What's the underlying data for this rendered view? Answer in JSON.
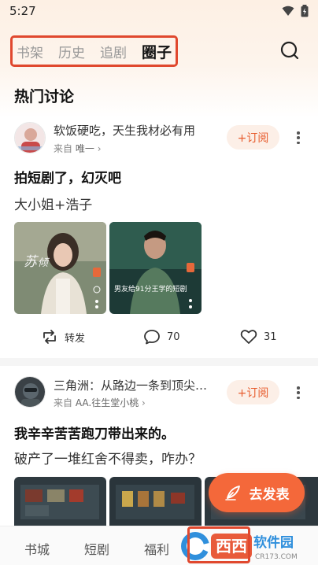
{
  "status_bar": {
    "time": "5:27"
  },
  "tabs": [
    {
      "label": "书架",
      "active": false
    },
    {
      "label": "历史",
      "active": false
    },
    {
      "label": "追剧",
      "active": false
    },
    {
      "label": "圈子",
      "active": true
    }
  ],
  "section_title": "热门讨论",
  "posts": [
    {
      "author": "软饭硬吃，天生我材必有用",
      "from_prefix": "来自",
      "from_source": "唯一",
      "subscribe_label": "+订阅",
      "title": "拍短剧了，幻灭吧",
      "body": "大小姐+浩子",
      "thumbs": [
        {
          "caption": ""
        },
        {
          "caption": "男友给91分王学的短剧"
        }
      ],
      "repost_label": "转发",
      "comment_count": "70",
      "like_count": "31"
    },
    {
      "author": "三角洲：从路边一条到顶尖…",
      "from_prefix": "来自",
      "from_source": "AA.往生堂小桃",
      "subscribe_label": "+订阅",
      "title": "我辛辛苦苦跑刀带出来的。",
      "body": "破产了一堆红舍不得卖，咋办？"
    }
  ],
  "fab_label": "去发表",
  "bottom_nav": [
    {
      "label": "书城"
    },
    {
      "label": "短剧"
    },
    {
      "label": "福利"
    }
  ],
  "watermark": {
    "text": "西西",
    "sub": "软件园",
    "domain": "CR173.COM"
  },
  "colors": {
    "accent": "#e75a2b",
    "fab": "#f4683a",
    "highlight": "#e0482e"
  }
}
